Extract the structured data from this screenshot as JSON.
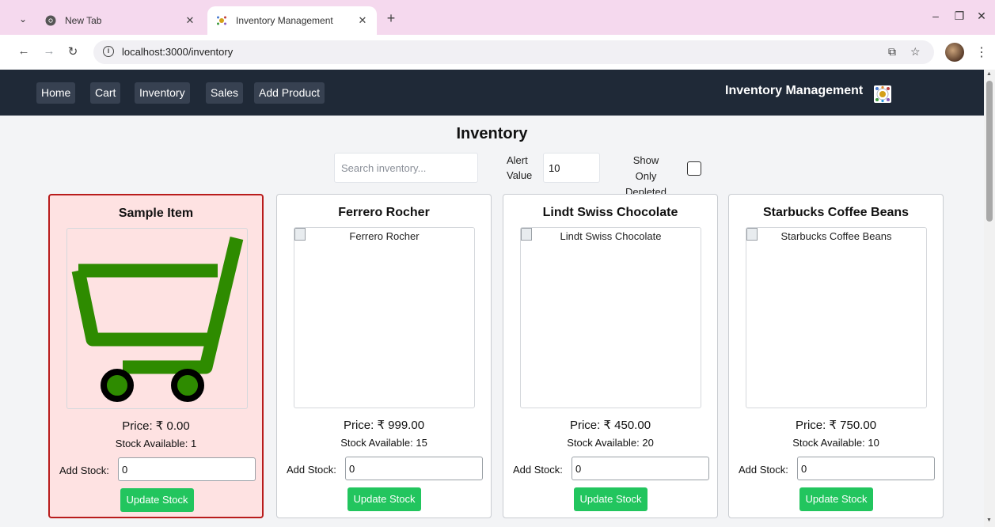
{
  "browser": {
    "tabs": [
      {
        "title": "New Tab",
        "favicon": "chrome-icon",
        "active": false
      },
      {
        "title": "Inventory Management",
        "favicon": "inventory-logo-icon",
        "active": true
      }
    ],
    "url": "localhost:3000/inventory"
  },
  "nav": {
    "links": [
      "Home",
      "Cart",
      "Inventory",
      "Sales",
      "Add Product"
    ],
    "brand": "Inventory Management"
  },
  "page": {
    "title": "Inventory",
    "search_placeholder": "Search inventory...",
    "alert_label": "Alert Value",
    "alert_value": "10",
    "depleted_label": "Show Only Depleted",
    "depleted_checked": false
  },
  "products": [
    {
      "name": "Sample Item",
      "image": "shopping-cart-image",
      "price": "Price: ₹ 0.00",
      "stock": "Stock Available: 1",
      "add_stock_label": "Add Stock:",
      "add_stock_value": "0",
      "button": "Update Stock",
      "alert": true
    },
    {
      "name": "Ferrero Rocher",
      "image_alt": "Ferrero Rocher",
      "price": "Price: ₹ 999.00",
      "stock": "Stock Available: 15",
      "add_stock_label": "Add Stock:",
      "add_stock_value": "0",
      "button": "Update Stock",
      "alert": false
    },
    {
      "name": "Lindt Swiss Chocolate",
      "image_alt": "Lindt Swiss Chocolate",
      "price": "Price: ₹ 450.00",
      "stock": "Stock Available: 20",
      "add_stock_label": "Add Stock:",
      "add_stock_value": "0",
      "button": "Update Stock",
      "alert": false
    },
    {
      "name": "Starbucks Coffee Beans",
      "image_alt": "Starbucks Coffee Beans",
      "price": "Price: ₹ 750.00",
      "stock": "Stock Available: 10",
      "add_stock_label": "Add Stock:",
      "add_stock_value": "0",
      "button": "Update Stock",
      "alert": false
    }
  ],
  "colors": {
    "nav_bg": "#1f2937",
    "alert_card_bg": "#fee2e2",
    "alert_card_border": "#b91c1c",
    "button_green": "#22c55e",
    "cart_green": "#2e8b00"
  }
}
